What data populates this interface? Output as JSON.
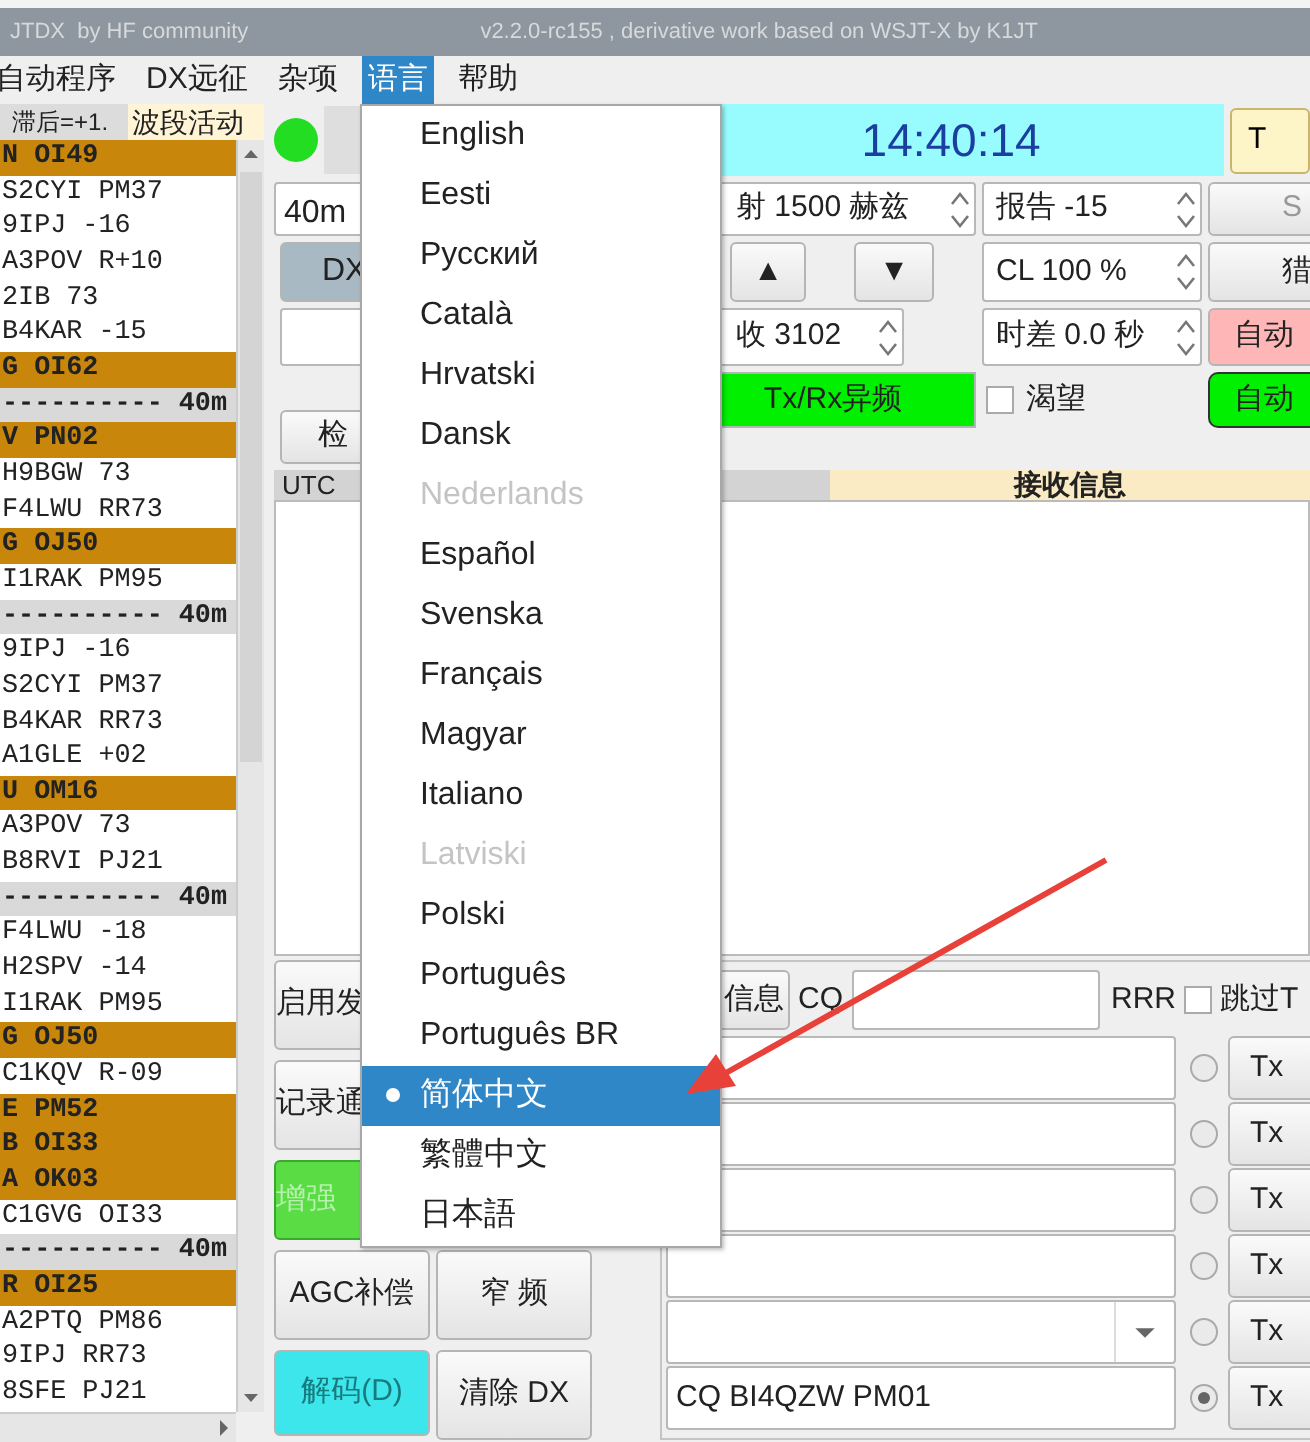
{
  "window": {
    "title": "JTDX  by HF community",
    "subtitle": "v2.2.0-rc155 , derivative work based on WSJT-X by K1JT"
  },
  "menu": [
    {
      "label": "自动程序",
      "selected": false
    },
    {
      "label": "DX远征",
      "selected": false
    },
    {
      "label": "杂项",
      "selected": false
    },
    {
      "label": "语言",
      "selected": true
    },
    {
      "label": "帮助",
      "selected": false
    }
  ],
  "band_activity": {
    "lag": "滞后=+1.",
    "title": "波段活动",
    "rows": [
      {
        "kind": "highlight",
        "text": "N OI49"
      },
      {
        "kind": "call",
        "text": "S2CYI PM37"
      },
      {
        "kind": "call",
        "text": "9IPJ -16"
      },
      {
        "kind": "call",
        "text": "A3POV R+10"
      },
      {
        "kind": "call",
        "text": "2IB 73"
      },
      {
        "kind": "call",
        "text": "B4KAR -15"
      },
      {
        "kind": "highlight",
        "text": "G OI62"
      },
      {
        "kind": "separator",
        "text": "---------- 40m"
      },
      {
        "kind": "highlight",
        "text": "V PN02"
      },
      {
        "kind": "call",
        "text": "H9BGW 73"
      },
      {
        "kind": "call",
        "text": "F4LWU RR73"
      },
      {
        "kind": "highlight",
        "text": "G OJ50"
      },
      {
        "kind": "call",
        "text": "I1RAK PM95"
      },
      {
        "kind": "separator",
        "text": "---------- 40m"
      },
      {
        "kind": "call",
        "text": "9IPJ -16"
      },
      {
        "kind": "call",
        "text": "S2CYI PM37"
      },
      {
        "kind": "call",
        "text": "B4KAR RR73"
      },
      {
        "kind": "call",
        "text": "A1GLE +02"
      },
      {
        "kind": "highlight",
        "text": "U OM16"
      },
      {
        "kind": "call",
        "text": "A3POV 73"
      },
      {
        "kind": "call",
        "text": "B8RVI PJ21"
      },
      {
        "kind": "separator",
        "text": "---------- 40m"
      },
      {
        "kind": "call",
        "text": "F4LWU -18"
      },
      {
        "kind": "call",
        "text": "H2SPV -14"
      },
      {
        "kind": "call",
        "text": "I1RAK PM95"
      },
      {
        "kind": "highlight",
        "text": "G OJ50"
      },
      {
        "kind": "call",
        "text": "C1KQV R-09"
      },
      {
        "kind": "highlight",
        "text": "E PM52"
      },
      {
        "kind": "highlight",
        "text": "B OI33"
      },
      {
        "kind": "highlight",
        "text": "A OK03"
      },
      {
        "kind": "call",
        "text": "C1GVG OI33"
      },
      {
        "kind": "separator",
        "text": "---------- 40m"
      },
      {
        "kind": "highlight",
        "text": "R OI25"
      },
      {
        "kind": "call",
        "text": "A2PTQ PM86"
      },
      {
        "kind": "call",
        "text": "9IPJ RR73"
      },
      {
        "kind": "call",
        "text": "8SFE PJ21"
      }
    ]
  },
  "controls": {
    "band": "40m",
    "dx_button": "DX",
    "check_button": "检",
    "clock": "14:40:14",
    "tx_button": "T",
    "tx_freq": "射 1500 赫兹",
    "report": "报告 -15",
    "s_button": "S",
    "up": "▲",
    "down": "▼",
    "cl": "CL  100 %",
    "guess_button": "猎",
    "rx_freq": "收 3102",
    "dt": "时差 0.0 秒",
    "auto_button": "自动",
    "split_button": "Tx/Rx异频",
    "want": {
      "label": "渴望",
      "checked": false
    },
    "auto_seq_button": "自动"
  },
  "decode_header": {
    "utc": "UTC",
    "rx": "接收信息"
  },
  "bottom_buttons": [
    {
      "kind": "plain",
      "label": "启用发"
    },
    {
      "kind": "plain",
      "label": "记录通"
    },
    {
      "kind": "green",
      "label": "增强"
    }
  ],
  "button_pairs": [
    [
      {
        "kind": "plain",
        "label": "AGC补偿"
      },
      {
        "kind": "plain",
        "label": "窄 频"
      }
    ],
    [
      {
        "kind": "cyan",
        "label": "解码(D)"
      },
      {
        "kind": "plain",
        "label": "清除 DX"
      }
    ]
  ],
  "messages": {
    "send_button": "信息",
    "cq_label": "CQ",
    "rrr_label": "RRR",
    "skip": {
      "label": "跳过T",
      "checked": false
    },
    "rows": [
      {
        "kind": "field",
        "selected": false,
        "button": "Tx"
      },
      {
        "kind": "field",
        "selected": false,
        "button": "Tx"
      },
      {
        "kind": "field",
        "selected": false,
        "button": "Tx"
      },
      {
        "kind": "field",
        "selected": false,
        "button": "Tx"
      },
      {
        "kind": "combo",
        "selected": false,
        "button": "Tx"
      },
      {
        "kind": "field",
        "selected": true,
        "text": "CQ BI4QZW PM01",
        "button": "Tx"
      }
    ]
  },
  "language_menu": [
    {
      "label": "English",
      "selected": false,
      "disabled": false
    },
    {
      "label": "Eesti",
      "selected": false,
      "disabled": false
    },
    {
      "label": "Русский",
      "selected": false,
      "disabled": false
    },
    {
      "label": "Català",
      "selected": false,
      "disabled": false
    },
    {
      "label": "Hrvatski",
      "selected": false,
      "disabled": false
    },
    {
      "label": "Dansk",
      "selected": false,
      "disabled": false
    },
    {
      "label": "Nederlands",
      "selected": false,
      "disabled": true
    },
    {
      "label": "Español",
      "selected": false,
      "disabled": false
    },
    {
      "label": "Svenska",
      "selected": false,
      "disabled": false
    },
    {
      "label": "Français",
      "selected": false,
      "disabled": false
    },
    {
      "label": "Magyar",
      "selected": false,
      "disabled": false
    },
    {
      "label": "Italiano",
      "selected": false,
      "disabled": false
    },
    {
      "label": "Latviski",
      "selected": false,
      "disabled": true
    },
    {
      "label": "Polski",
      "selected": false,
      "disabled": false
    },
    {
      "label": "Português",
      "selected": false,
      "disabled": false
    },
    {
      "label": "Português BR",
      "selected": false,
      "disabled": false
    },
    {
      "label": "简体中文",
      "selected": true,
      "disabled": false
    },
    {
      "label": "繁體中文",
      "selected": false,
      "disabled": false
    },
    {
      "label": "日本語",
      "selected": false,
      "disabled": false
    }
  ],
  "annotation": {
    "kind": "arrow"
  }
}
